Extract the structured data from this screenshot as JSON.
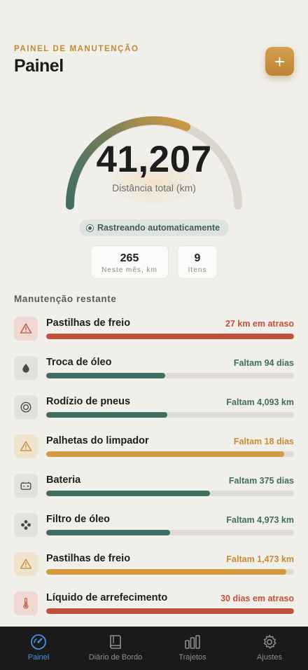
{
  "header": {
    "eyebrow": "PAINEL DE MANUTENÇÃO",
    "title": "Painel",
    "add_label": "+"
  },
  "gauge": {
    "value": "41,207",
    "label": "Distância total (km)"
  },
  "tracking": {
    "label": "Rastreando automaticamente"
  },
  "stats": [
    {
      "value": "265",
      "label": "Neste mês, km"
    },
    {
      "value": "9",
      "label": "Itens"
    }
  ],
  "maintenance": {
    "title": "Manutenção restante",
    "items": [
      {
        "name": "Pastilhas de freio",
        "status": "27 km em atraso",
        "status_color": "#c0513a",
        "progress": 1.0,
        "bar_color": "#c0513a",
        "icon": "warning-triangle-icon",
        "icon_color": "#c0513a",
        "icon_bg": "#f0d9d3"
      },
      {
        "name": "Troca de óleo",
        "status": "Faltam 94 dias",
        "status_color": "#3f6f62",
        "progress": 0.48,
        "bar_color": "#3f6f62",
        "icon": "oil-drop-icon",
        "icon_color": "#4a4a4a",
        "icon_bg": "#e3e1dd"
      },
      {
        "name": "Rodízio de pneus",
        "status": "Faltam 4,093 km",
        "status_color": "#3f6f62",
        "progress": 0.49,
        "bar_color": "#3f6f62",
        "icon": "tire-icon",
        "icon_color": "#4a4a4a",
        "icon_bg": "#e3e1dd"
      },
      {
        "name": "Palhetas do limpador",
        "status": "Faltam 18 dias",
        "status_color": "#c98a30",
        "progress": 0.96,
        "bar_color": "#d39a44",
        "icon": "warning-triangle-icon",
        "icon_color": "#c98a30",
        "icon_bg": "#f1e4cf"
      },
      {
        "name": "Bateria",
        "status": "Faltam 375 dias",
        "status_color": "#3f6f62",
        "progress": 0.66,
        "bar_color": "#3f6f62",
        "icon": "battery-icon",
        "icon_color": "#4a4a4a",
        "icon_bg": "#e3e1dd"
      },
      {
        "name": "Filtro de óleo",
        "status": "Faltam 4,973 km",
        "status_color": "#3f6f62",
        "progress": 0.5,
        "bar_color": "#3f6f62",
        "icon": "filter-icon",
        "icon_color": "#4a4a4a",
        "icon_bg": "#e3e1dd"
      },
      {
        "name": "Pastilhas de freio",
        "status": "Faltam 1,473 km",
        "status_color": "#c98a30",
        "progress": 0.97,
        "bar_color": "#d39a44",
        "icon": "warning-triangle-icon",
        "icon_color": "#c98a30",
        "icon_bg": "#f1e4cf"
      },
      {
        "name": "Líquido de arrefecimento",
        "status": "30 dias em atraso",
        "status_color": "#c0513a",
        "progress": 1.0,
        "bar_color": "#c0513a",
        "icon": "thermometer-icon",
        "icon_color": "#c0513a",
        "icon_bg": "#f0d9d3"
      }
    ]
  },
  "tabs": [
    {
      "label": "Painel",
      "icon": "gauge-icon",
      "active": true
    },
    {
      "label": "Diário de Bordo",
      "icon": "book-icon",
      "active": false
    },
    {
      "label": "Trajetos",
      "icon": "bars-icon",
      "active": false
    },
    {
      "label": "Ajustes",
      "icon": "gear-icon",
      "active": false
    }
  ],
  "colors": {
    "accent": "#c08a32",
    "green": "#3f6f62",
    "red": "#c0513a",
    "amber": "#d39a44",
    "tab_active": "#4a90e8"
  }
}
